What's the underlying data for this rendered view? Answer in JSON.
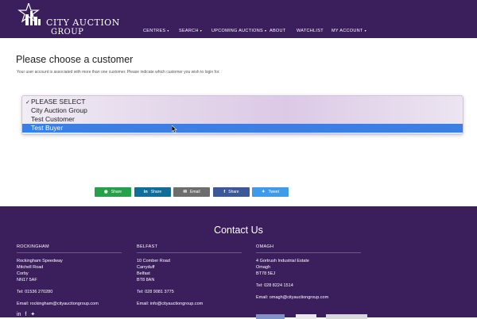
{
  "header": {
    "logo_line1": "CITY AUCTION",
    "logo_line2": "GROUP",
    "nav": [
      {
        "label": "CENTRES",
        "caret": "▾"
      },
      {
        "label": "SEARCH",
        "caret": "▾"
      },
      {
        "label": "UPCOMING AUCTIONS",
        "caret": "▾"
      },
      {
        "label": "ABOUT",
        "caret": ""
      },
      {
        "label": "WATCHLIST",
        "caret": ""
      },
      {
        "label": "MY ACCOUNT",
        "caret": "▾"
      }
    ]
  },
  "main": {
    "title": "Please choose a customer",
    "description": "Your user account is associated with more than one customer. Please indicate which customer you wish to login for.",
    "customer_select": {
      "options": [
        "PLEASE SELECT",
        "City Auction Group",
        "Test Customer",
        "Test Buyer"
      ],
      "checked": "PLEASE SELECT",
      "check_mark": "✓",
      "highlighted": "Test Buyer"
    }
  },
  "share": {
    "buttons": [
      {
        "label": "Share",
        "icon": "whatsapp-icon",
        "glyph": "◉",
        "color": "#25a14a"
      },
      {
        "label": "Share",
        "icon": "linkedin-icon",
        "glyph": "in",
        "color": "#0e6e98"
      },
      {
        "label": "Email",
        "icon": "email-icon",
        "glyph": "✉",
        "color": "#6d6d6d"
      },
      {
        "label": "Share",
        "icon": "facebook-icon",
        "glyph": "f",
        "color": "#3b5998"
      },
      {
        "label": "Tweet",
        "icon": "twitter-icon",
        "glyph": "✦",
        "color": "#3d9be9"
      }
    ]
  },
  "footer": {
    "title": "Contact Us",
    "columns": [
      {
        "heading": "ROCKINGHAM",
        "address": [
          "Rockingham Speedway",
          "Mitchell Road",
          "Corby",
          "NN17 5AF"
        ],
        "tel": "Tel: 01536 270280",
        "email": "Email: rockingham@cityauctiongroup.com"
      },
      {
        "heading": "BELFAST",
        "address": [
          "10 Comber Road",
          "Carryduff",
          "Belfast",
          "BT8 8AN"
        ],
        "tel": "Tel: 028 9081 3775",
        "email": "Email: info@cityauctiongroup.com"
      },
      {
        "heading": "OMAGH",
        "address": [
          "4 Gortrush Industrial Estate",
          "Omagh",
          "BT78 5EJ"
        ],
        "tel": "Tel: 028 8224 1514",
        "email": "Email: omagh@cityauctiongroup.com"
      }
    ],
    "social_icons": [
      "linkedin-icon",
      "facebook-icon",
      "twitter-icon"
    ]
  },
  "colors": {
    "brand_purple": "#3a1f5c",
    "highlight_blue": "#3b7ee5"
  }
}
